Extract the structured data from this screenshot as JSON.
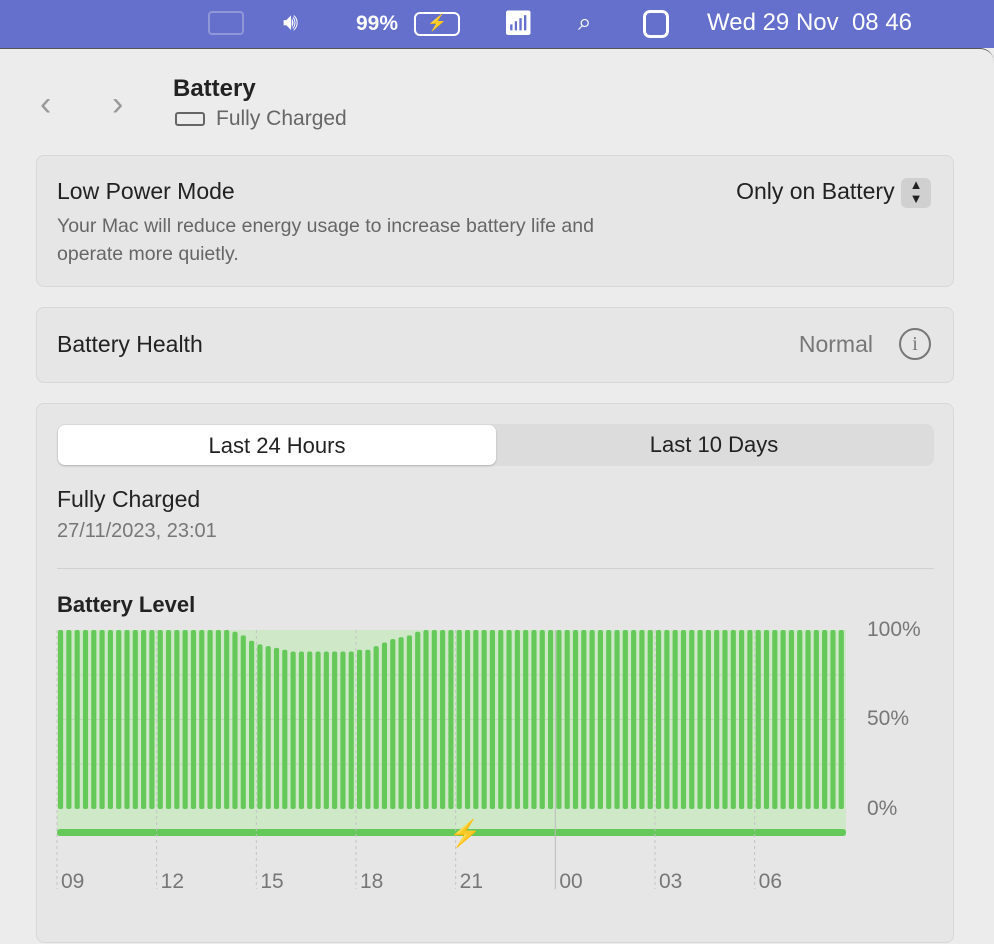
{
  "menubar": {
    "battery_percent": "99%",
    "datetime": "Wed 29 Nov  08 46",
    "icons": [
      "stage-manager-icon",
      "volume-icon",
      "battery-charging-icon",
      "wifi-icon",
      "search-icon",
      "control-center-icon"
    ]
  },
  "header": {
    "title": "Battery",
    "status": "Fully Charged"
  },
  "low_power": {
    "label": "Low Power Mode",
    "description": "Your Mac will reduce energy usage to increase battery life and operate more quietly.",
    "value": "Only on Battery"
  },
  "health": {
    "label": "Battery Health",
    "value": "Normal"
  },
  "tabs": [
    {
      "label": "Last 24 Hours",
      "selected": true
    },
    {
      "label": "Last 10 Days",
      "selected": false
    }
  ],
  "last_charge": {
    "label": "Fully Charged",
    "timestamp": "27/11/2023, 23:01"
  },
  "chart": {
    "title": "Battery Level",
    "accent": "#65c95a"
  },
  "chart_data": {
    "type": "bar",
    "title": "Battery Level",
    "interval_minutes": 15,
    "start": "09:00",
    "x_ticks": [
      "09",
      "12",
      "15",
      "18",
      "21",
      "00",
      "03",
      "06"
    ],
    "y_ticks": [
      "100%",
      "50%",
      "0%"
    ],
    "ylim": [
      0,
      100
    ],
    "values": [
      100,
      100,
      100,
      100,
      100,
      100,
      100,
      100,
      100,
      100,
      100,
      100,
      100,
      100,
      100,
      100,
      100,
      100,
      100,
      100,
      100,
      99,
      97,
      94,
      92,
      91,
      90,
      89,
      88,
      88,
      88,
      88,
      88,
      88,
      88,
      88,
      89,
      89,
      91,
      93,
      95,
      96,
      97,
      99,
      100,
      100,
      100,
      100,
      100,
      100,
      100,
      100,
      100,
      100,
      100,
      100,
      100,
      100,
      100,
      100,
      100,
      100,
      100,
      100,
      100,
      100,
      100,
      100,
      100,
      100,
      100,
      100,
      100,
      100,
      100,
      100,
      100,
      100,
      100,
      100,
      100,
      100,
      100,
      100,
      100,
      100,
      100,
      100,
      100,
      100,
      100,
      100,
      100,
      100,
      100
    ],
    "charging": "entire period"
  }
}
